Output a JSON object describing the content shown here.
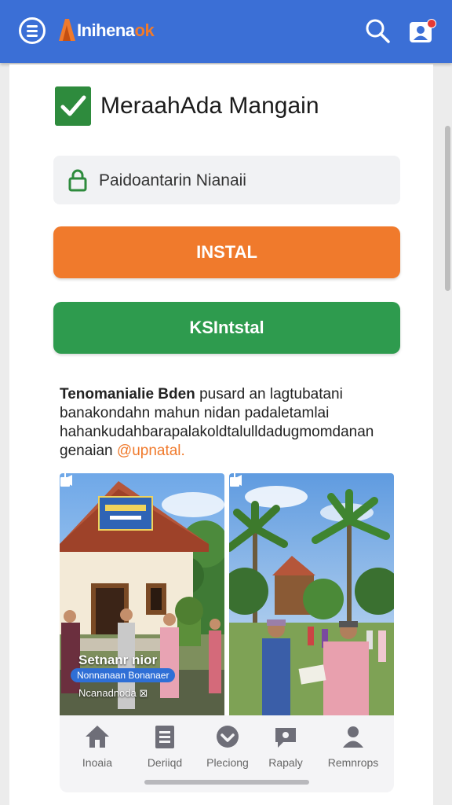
{
  "header": {
    "logo_text_main": "Inihena",
    "logo_text_accent": "ok",
    "menu_icon": "menu-icon",
    "search_icon": "search-icon",
    "profile_icon": "profile-icon",
    "brand_color": "#3b6fd6",
    "accent_color": "#f07a2c"
  },
  "main": {
    "title": "MeraahAda Mangain",
    "password_field_value": "Paidoantarin Nianaii",
    "install_button_label": "INSTAL",
    "secondary_button_label": "KSIntstal",
    "description_bold": "Tenomanialie Bden",
    "description_text": " pusard an lagtubatani banakondahn mahun nidan padaletamlai hahankudahbarapalakoldtalulldadugmomdanan genaian ",
    "description_link": "@upnatal."
  },
  "photos": [
    {
      "caption_title": "Setnanr nior",
      "caption_tag": "Nonnanaan Bonanaer",
      "caption_sub": "Ncanadnoda ⊠"
    },
    {
      "caption_title": "",
      "caption_tag": "",
      "caption_sub": ""
    }
  ],
  "bottom_nav": [
    {
      "label": "Inoaia",
      "icon": "home-icon"
    },
    {
      "label": "Deriiqd",
      "icon": "document-icon"
    },
    {
      "label": "Pleciong",
      "icon": "check-circle-icon"
    },
    {
      "label": "Rapaly",
      "icon": "chat-icon"
    },
    {
      "label": "Remnrops",
      "icon": "person-icon"
    }
  ]
}
